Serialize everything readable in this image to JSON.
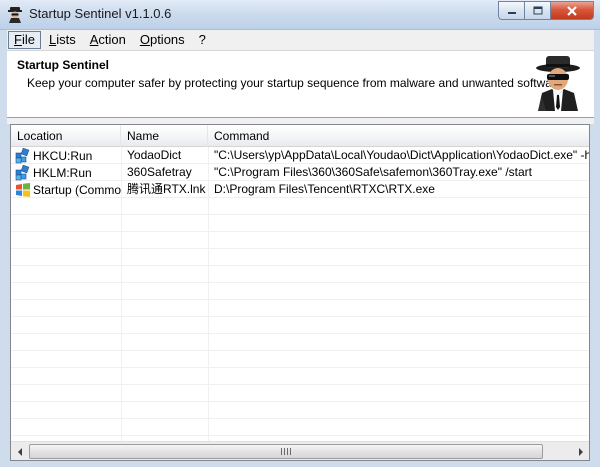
{
  "window": {
    "title": "Startup Sentinel v1.1.0.6"
  },
  "menu": {
    "items": [
      {
        "label": "File",
        "active": true
      },
      {
        "label": "Lists",
        "active": false
      },
      {
        "label": "Action",
        "active": false
      },
      {
        "label": "Options",
        "active": false
      },
      {
        "label": "?",
        "active": false
      }
    ]
  },
  "header": {
    "title": "Startup Sentinel",
    "subtitle": "Keep your computer safer by protecting your startup sequence from malware and unwanted software"
  },
  "table": {
    "columns": [
      "Location",
      "Name",
      "Command"
    ],
    "rows": [
      {
        "location": "HKCU:Run",
        "name": "YodaoDict",
        "command": "\"C:\\Users\\yp\\AppData\\Local\\Youdao\\Dict\\Application\\YodaoDict.exe\" -hide",
        "icon": "registry-icon"
      },
      {
        "location": "HKLM:Run",
        "name": "360Safetray",
        "command": "\"C:\\Program Files\\360\\360Safe\\safemon\\360Tray.exe\" /start",
        "icon": "registry-icon"
      },
      {
        "location": "Startup (Common)",
        "name": "腾讯通RTX.lnk",
        "command": "D:\\Program Files\\Tencent\\RTXC\\RTX.exe",
        "icon": "windows-flag-icon"
      }
    ]
  },
  "icons": {
    "app": "agent-icon",
    "minimize": "minimize-icon",
    "maximize": "maximize-icon",
    "close": "close-icon"
  },
  "colors": {
    "titlebar": "#cddcee",
    "close_button": "#c23a1c",
    "menu_bg": "#f0f0f0",
    "list_border": "#828790"
  }
}
